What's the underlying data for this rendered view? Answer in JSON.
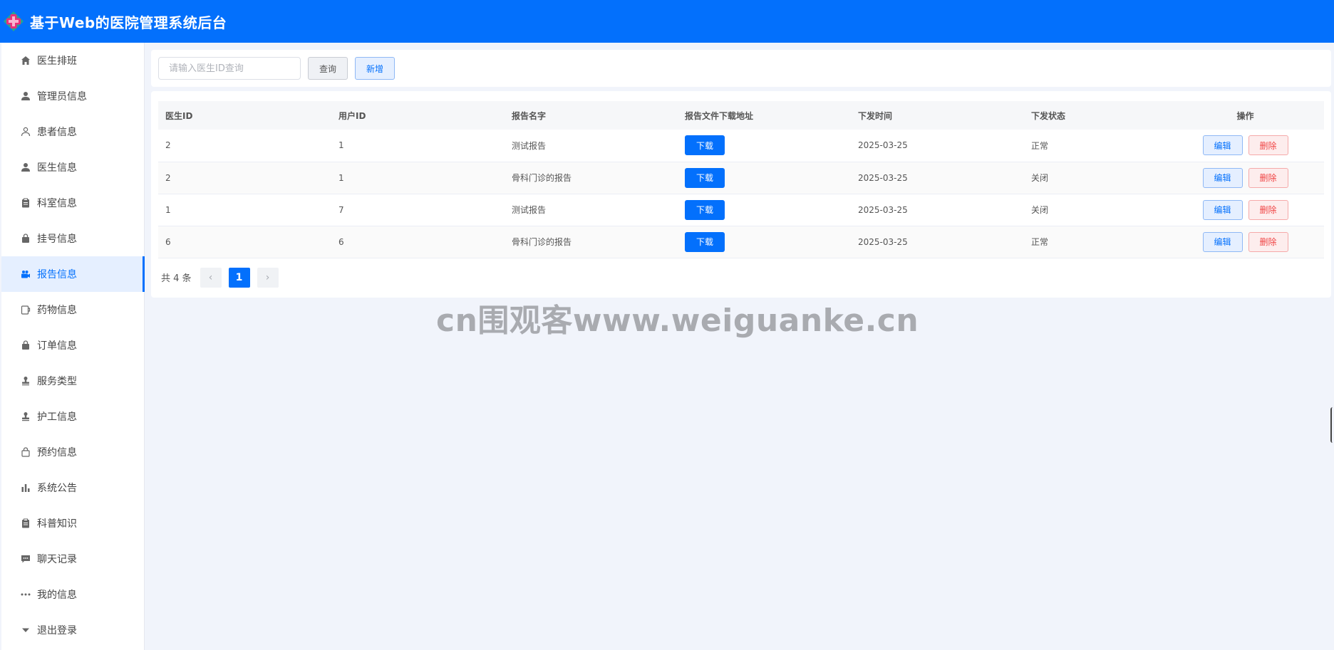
{
  "app": {
    "title": "基于Web的医院管理系统后台"
  },
  "sidebar": {
    "items": [
      {
        "label": "医生排班",
        "icon": "home-icon"
      },
      {
        "label": "管理员信息",
        "icon": "user-icon"
      },
      {
        "label": "患者信息",
        "icon": "user-outline-icon"
      },
      {
        "label": "医生信息",
        "icon": "user-icon"
      },
      {
        "label": "科室信息",
        "icon": "clipboard-icon"
      },
      {
        "label": "挂号信息",
        "icon": "bag-icon"
      },
      {
        "label": "报告信息",
        "icon": "camera-icon",
        "active": true
      },
      {
        "label": "药物信息",
        "icon": "cup-icon"
      },
      {
        "label": "订单信息",
        "icon": "bag-icon"
      },
      {
        "label": "服务类型",
        "icon": "stamp-icon"
      },
      {
        "label": "护工信息",
        "icon": "stamp-icon"
      },
      {
        "label": "预约信息",
        "icon": "shopping-bag-icon"
      },
      {
        "label": "系统公告",
        "icon": "bar-chart-icon"
      },
      {
        "label": "科普知识",
        "icon": "clipboard-icon"
      },
      {
        "label": "聊天记录",
        "icon": "chat-icon"
      },
      {
        "label": "我的信息",
        "icon": "more-dots-icon"
      },
      {
        "label": "退出登录",
        "icon": "caret-down-icon"
      }
    ]
  },
  "toolbar": {
    "search_placeholder": "请输入医生ID查询",
    "search_value": "",
    "query_label": "查询",
    "add_label": "新增"
  },
  "table": {
    "headers": [
      "医生ID",
      "用户ID",
      "报告名字",
      "报告文件下载地址",
      "下发时间",
      "下发状态",
      "操作"
    ],
    "rows": [
      {
        "doctor_id": "2",
        "user_id": "1",
        "report_name": "测试报告",
        "download_label": "下载",
        "time": "2025-03-25",
        "status": "正常",
        "edit_label": "编辑",
        "delete_label": "删除"
      },
      {
        "doctor_id": "2",
        "user_id": "1",
        "report_name": "骨科门诊的报告",
        "download_label": "下载",
        "time": "2025-03-25",
        "status": "关闭",
        "edit_label": "编辑",
        "delete_label": "删除"
      },
      {
        "doctor_id": "1",
        "user_id": "7",
        "report_name": "测试报告",
        "download_label": "下载",
        "time": "2025-03-25",
        "status": "关闭",
        "edit_label": "编辑",
        "delete_label": "删除"
      },
      {
        "doctor_id": "6",
        "user_id": "6",
        "report_name": "骨科门诊的报告",
        "download_label": "下载",
        "time": "2025-03-25",
        "status": "正常",
        "edit_label": "编辑",
        "delete_label": "删除"
      }
    ]
  },
  "pagination": {
    "total_label": "共 4 条",
    "prev": "‹",
    "current_page": "1",
    "next": "›"
  },
  "watermark": "cn围观客www.weiguanke.cn",
  "colors": {
    "primary": "#0370fc",
    "danger": "#f04545",
    "background": "#f1f4fb",
    "logo_cross": "#e8307a",
    "logo_diamond": "#27a58e"
  }
}
